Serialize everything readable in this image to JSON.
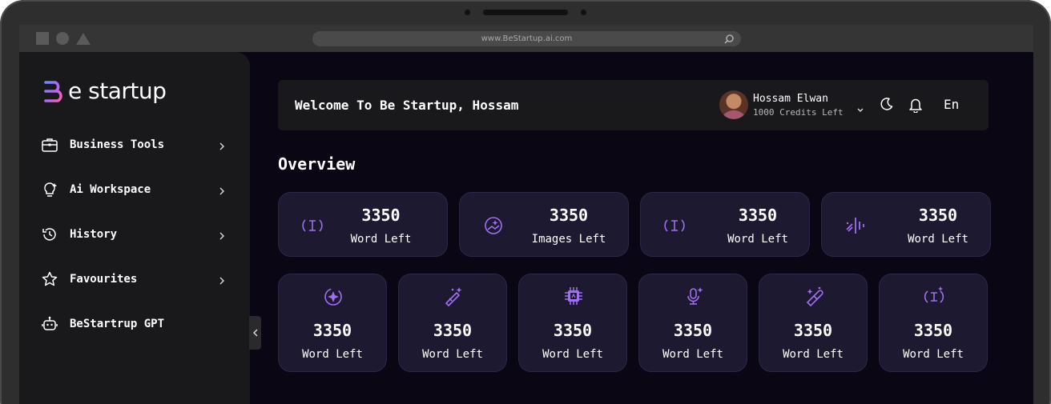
{
  "browser": {
    "url": "www.BeStartup.ai.com"
  },
  "brand": {
    "logo_text": "e startup",
    "accent": "#a070f0"
  },
  "sidebar": {
    "items": [
      {
        "label": "Business Tools",
        "icon": "briefcase-icon"
      },
      {
        "label": "Ai Workspace",
        "icon": "lightbulb-icon"
      },
      {
        "label": "History",
        "icon": "history-icon"
      },
      {
        "label": "Favourites",
        "icon": "star-icon"
      },
      {
        "label": "BeStartrup GPT",
        "icon": "robot-icon"
      }
    ]
  },
  "header": {
    "welcome": "Welcome To Be Startup, Hossam",
    "user_name": "Hossam Elwan",
    "credits": "1000 Credits Left",
    "language": "En"
  },
  "overview": {
    "title": "Overview",
    "stats": [
      {
        "value": "3350",
        "label": "Word Left",
        "icon": "text-cursor-icon"
      },
      {
        "value": "3350",
        "label": "Images Left",
        "icon": "image-sparkle-icon"
      },
      {
        "value": "3350",
        "label": "Word Left",
        "icon": "text-cursor-icon"
      },
      {
        "value": "3350",
        "label": "Word Left",
        "icon": "audio-wave-icon"
      }
    ],
    "tools": [
      {
        "value": "3350",
        "label": "Word Left",
        "icon": "sparkle-icon"
      },
      {
        "value": "3350",
        "label": "Word Left",
        "icon": "magic-wand-icon"
      },
      {
        "value": "3350",
        "label": "Word Left",
        "icon": "chip-icon"
      },
      {
        "value": "3350",
        "label": "Word Left",
        "icon": "microphone-icon"
      },
      {
        "value": "3350",
        "label": "Word Left",
        "icon": "brush-icon"
      },
      {
        "value": "3350",
        "label": "Word Left",
        "icon": "text-cursor-icon"
      }
    ]
  }
}
